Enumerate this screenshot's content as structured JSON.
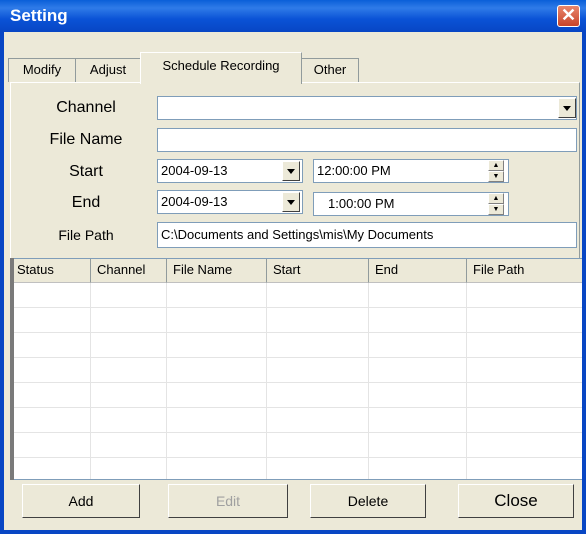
{
  "window": {
    "title": "Setting",
    "close_glyph": "✕"
  },
  "tabs": [
    {
      "label": "Modify",
      "active": false
    },
    {
      "label": "Adjust",
      "active": false
    },
    {
      "label": "Schedule Recording",
      "active": true
    },
    {
      "label": "Other",
      "active": false
    }
  ],
  "form": {
    "channel_label": "Channel",
    "channel_value": "",
    "filename_label": "File Name",
    "filename_value": "",
    "start_label": "Start",
    "start_date": "2004-09-13",
    "start_time": "12:00:00 PM",
    "end_label": "End",
    "end_date": "2004-09-13",
    "end_time": "1:00:00 PM",
    "filepath_label": "File Path",
    "filepath_value": "C:\\Documents and Settings\\mis\\My Documents"
  },
  "table": {
    "columns": [
      "Status",
      "Channel",
      "File Name",
      "Start",
      "End",
      "File Path"
    ],
    "rows": []
  },
  "buttons": {
    "add": "Add",
    "edit": "Edit",
    "delete": "Delete",
    "close": "Close"
  },
  "colors": {
    "titlebar": "#0a52d6",
    "face": "#ece9d8",
    "close_button": "#d4573a"
  }
}
